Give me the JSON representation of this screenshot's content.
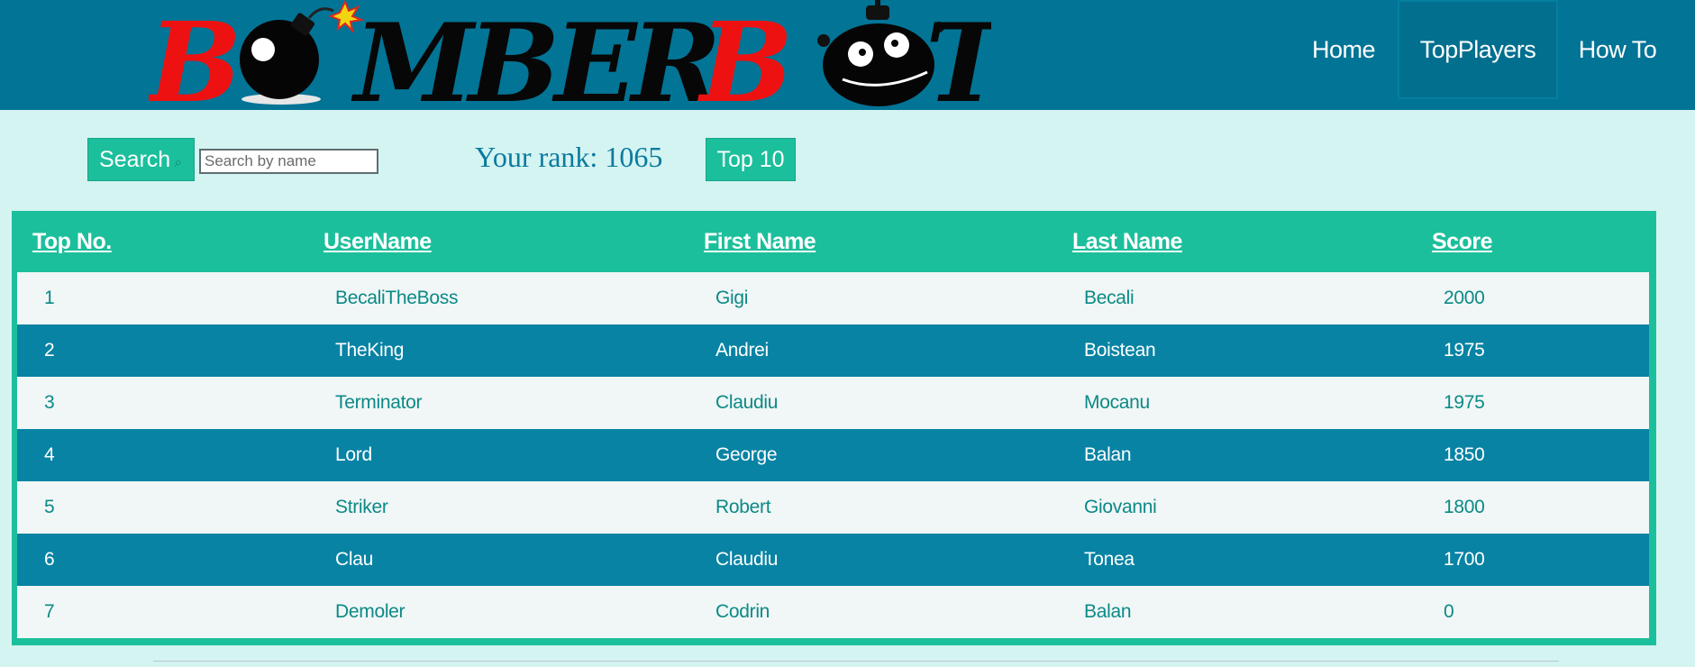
{
  "logo": {
    "text": "BOMBERBOT",
    "colors": {
      "red": "#ee1111",
      "black": "#070707"
    }
  },
  "nav": {
    "items": [
      {
        "label": "Home"
      },
      {
        "label": "TopPlayers",
        "active": true
      },
      {
        "label": "How To"
      }
    ]
  },
  "toolbar": {
    "search_label": "Search",
    "search_icon": "search-icon",
    "search_placeholder": "Search by name",
    "search_value": "",
    "rank_text": "Your rank: 1065",
    "top10_label": "Top 10"
  },
  "table": {
    "headers": [
      "Top No.",
      "UserName",
      "First Name",
      "Last Name",
      "Score"
    ],
    "rows": [
      [
        "1",
        "BecaliTheBoss",
        "Gigi",
        "Becali",
        "2000"
      ],
      [
        "2",
        "TheKing",
        "Andrei",
        "Boistean",
        "1975"
      ],
      [
        "3",
        "Terminator",
        "Claudiu",
        "Mocanu",
        "1975"
      ],
      [
        "4",
        "Lord",
        "George",
        "Balan",
        "1850"
      ],
      [
        "5",
        "Striker",
        "Robert",
        "Giovanni",
        "1800"
      ],
      [
        "6",
        "Clau",
        "Claudiu",
        "Tonea",
        "1700"
      ],
      [
        "7",
        "Demoler",
        "Codrin",
        "Balan",
        "0"
      ]
    ]
  },
  "colors": {
    "header_bg": "#027496",
    "page_bg": "#d4f4f2",
    "accent": "#1cbf9c",
    "row_dark": "#0883a4",
    "row_light": "#f1f6f6",
    "rank_text": "#0b7aa0"
  }
}
